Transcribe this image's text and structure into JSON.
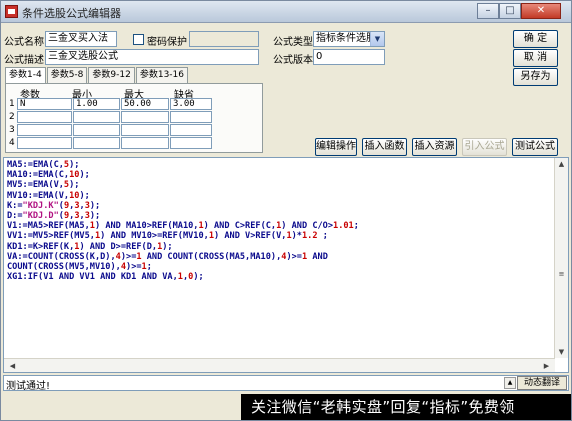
{
  "window": {
    "title": "条件选股公式编辑器"
  },
  "form": {
    "name_label": "公式名称",
    "name_value": "三金叉买入法",
    "password_label": "密码保护",
    "password_value": "",
    "type_label": "公式类型",
    "type_value": "指标条件选股",
    "desc_label": "公式描述",
    "desc_value": "三金叉选股公式",
    "version_label": "公式版本",
    "version_value": "0"
  },
  "buttons": {
    "ok": "确 定",
    "cancel": "取 消",
    "save_as": "另存为",
    "edit_ops": "编辑操作",
    "insert_func": "插入函数",
    "insert_res": "插入资源",
    "import_formula": "引入公式",
    "test_formula": "测试公式"
  },
  "tabs": [
    "参数1-4",
    "参数5-8",
    "参数9-12",
    "参数13-16"
  ],
  "params": {
    "headers": [
      "参数",
      "最小",
      "最大",
      "缺省"
    ],
    "rows": [
      {
        "num": "1",
        "name": "N",
        "min": "1.00",
        "max": "50.00",
        "def": "3.00"
      },
      {
        "num": "2",
        "name": "",
        "min": "",
        "max": "",
        "def": ""
      },
      {
        "num": "3",
        "name": "",
        "min": "",
        "max": "",
        "def": ""
      },
      {
        "num": "4",
        "name": "",
        "min": "",
        "max": "",
        "def": ""
      }
    ]
  },
  "code_lines": [
    "MA5:=EMA(C,5);",
    "MA10:=EMA(C,10);",
    "MV5:=EMA(V,5);",
    "MV10:=EMA(V,10);",
    "K:=\"KDJ.K\"(9,3,3);",
    "D:=\"KDJ.D\"(9,3,3);",
    "V1:=MA5>REF(MA5,1) AND MA10>REF(MA10,1) AND C>REF(C,1) AND C/O>1.01;",
    "VV1:=MV5>REF(MV5,1) AND MV10>=REF(MV10,1) AND V>REF(V,1)*1.2 ;",
    "KD1:=K>REF(K,1) AND D>=REF(D,1);",
    "VA:=COUNT(CROSS(K,D),4)>=1 AND COUNT(CROSS(MA5,MA10),4)>=1 AND",
    "COUNT(CROSS(MV5,MV10),4)>=1;",
    "XG1:IF(V1 AND VV1 AND KD1 AND VA,1,0);"
  ],
  "status": {
    "text": "测试通过!",
    "translate": "动态翻译"
  },
  "watermark": "关注微信“老韩实盘”回复“指标”免费领",
  "colors": {
    "keyword": "#0a0a8c",
    "number": "#c80000",
    "string": "#b01080"
  }
}
